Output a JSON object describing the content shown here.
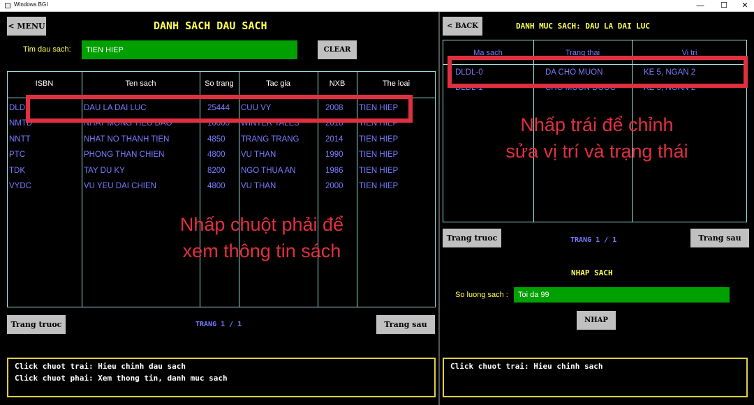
{
  "window": {
    "title": "Windows BGI",
    "minimize": "—",
    "maximize": "☐",
    "close": "✕"
  },
  "left": {
    "menu_button": "< MENU",
    "title": "DANH SACH DAU SACH",
    "search_label": "Tim dau sach:",
    "search_value": "TIEN HIEP",
    "clear_button": "CLEAR",
    "columns": [
      "ISBN",
      "Ten sach",
      "So trang",
      "Tac gia",
      "NXB",
      "The loai"
    ],
    "rows": [
      [
        "DLDL",
        "DAU LA DAI LUC",
        "25444",
        "CUU VY",
        "2008",
        "TIEN HIEP"
      ],
      [
        "NMTD",
        "NHAT MONG TIEU DAO",
        "10000",
        "WINTER TALES",
        "2018",
        "TIEN HIEP"
      ],
      [
        "NNTT",
        "NHAT NO THANH TIEN",
        "4850",
        "TRANG TRANG",
        "2014",
        "TIEN HIEP"
      ],
      [
        "PTC",
        "PHONG THAN CHIEN",
        "4800",
        "VU THAN",
        "1990",
        "TIEN HIEP"
      ],
      [
        "TDK",
        "TAY DU KY",
        "8200",
        "NGO THUA AN",
        "1986",
        "TIEN HIEP"
      ],
      [
        "VYDC",
        "VU YEU DAI CHIEN",
        "4800",
        "VU THAN",
        "2000",
        "TIEN HIEP"
      ]
    ],
    "prev_button": "Trang truoc",
    "page_label": "TRANG 1 / 1",
    "next_button": "Trang sau",
    "hints": [
      "Click chuot trai: Hieu chinh dau sach",
      "Click chuot phai: Xem thong tin, danh muc sach"
    ],
    "annotation": [
      "Nhấp chuột phải để",
      "xem thông tin sách"
    ]
  },
  "right": {
    "back_button": "< BACK",
    "title": "DANH MUC SACH: DAU LA DAI LUC",
    "columns": [
      "Ma sach",
      "Trang thai",
      "Vi tri"
    ],
    "rows": [
      [
        "DLDL-0",
        "DA CHO MUON",
        "KE 5, NGAN 2"
      ],
      [
        "DLDL-1",
        "CHO MUON DUOC",
        "KE 5, NGAN 2"
      ]
    ],
    "prev_button": "Trang truoc",
    "page_label": "TRANG 1 / 1",
    "next_button": "Trang sau",
    "import_title": "NHAP SACH",
    "qty_label": "So luong sach :",
    "qty_placeholder": "Toi da 99",
    "import_button": "NHAP",
    "hints": [
      "Click chuot trai: Hieu chinh sach"
    ],
    "annotation": [
      "Nhấp trái để chỉnh",
      "sửa vị trí và trạng thái"
    ]
  },
  "colors": {
    "title": "#ffff55",
    "field": "#00a000",
    "cell_text": "#7a7aff",
    "highlight": "#e03040",
    "grid": "#a0e0e0"
  }
}
